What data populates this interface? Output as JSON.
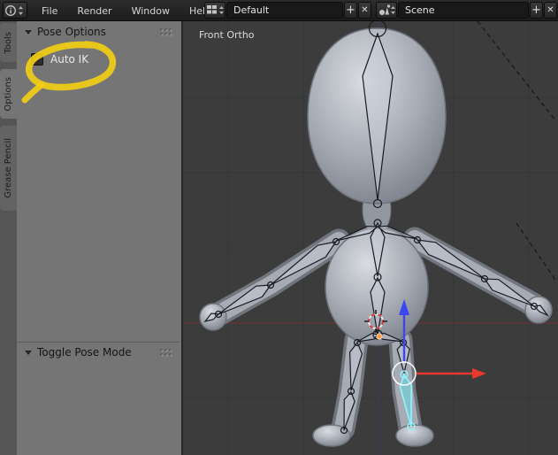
{
  "menubar": {
    "menus": [
      {
        "label": "File"
      },
      {
        "label": "Render"
      },
      {
        "label": "Window"
      },
      {
        "label": "Help"
      }
    ],
    "screen_layout": {
      "value": "Default",
      "add": "+",
      "remove": "✕"
    },
    "scene": {
      "value": "Scene",
      "add": "+",
      "remove": "✕"
    }
  },
  "toolshelf": {
    "tabs": [
      {
        "label": "Tools",
        "active": false
      },
      {
        "label": "Options",
        "active": true
      },
      {
        "label": "Grease Pencil",
        "active": false
      }
    ],
    "pose_options_panel": {
      "title": "Pose Options"
    },
    "auto_ik": {
      "label": "Auto IK",
      "checked": true,
      "check_glyph": "✓"
    },
    "toggle_pose_mode_panel": {
      "title": "Toggle Pose Mode"
    }
  },
  "viewport": {
    "overlay_label": "Front Ortho"
  },
  "colors": {
    "annotation_yellow": "#f1ce15",
    "axis_x": "#e8392c",
    "axis_z": "#3c46f0",
    "selected_bone_stroke": "#8ef6ff",
    "grid_axis_x_line": "#5e3434",
    "grid_axis_z_line": "#3a3a5e",
    "cursor_red": "#cf3a3a",
    "origin_orange": "#ff9a40"
  }
}
